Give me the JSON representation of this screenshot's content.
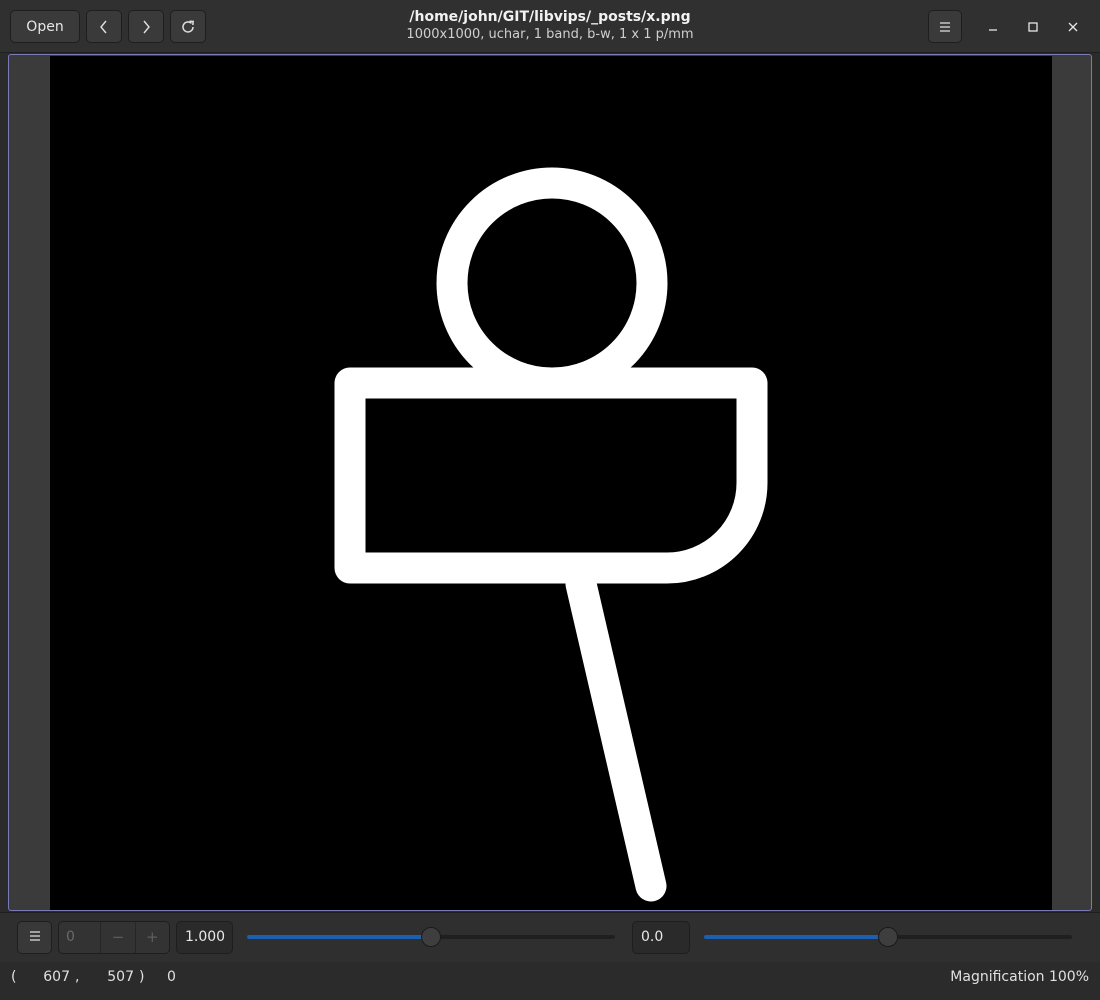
{
  "header": {
    "open_label": "Open",
    "title": "/home/john/GIT/libvips/_posts/x.png",
    "subtitle": "1000x1000,  uchar, 1 band, b-w, 1 x 1 p/mm",
    "icons": [
      "back-icon",
      "forward-icon",
      "reload-icon",
      "hamburger-menu-icon",
      "minimize-icon",
      "maximize-icon",
      "close-icon"
    ]
  },
  "controls": {
    "page_value": "0",
    "page_minus": "−",
    "page_plus": "+",
    "scale_value": "1.000",
    "scale_slider_fraction": 0.5,
    "offset_value": "0.0",
    "offset_slider_fraction": 0.5,
    "accent_color": "#1c5fb0"
  },
  "status": {
    "paren_open": "(",
    "x": "607",
    "comma": ",",
    "y": "507",
    "paren_close": ")",
    "pixel_value": "0",
    "magnification": "Magnification 100%"
  }
}
